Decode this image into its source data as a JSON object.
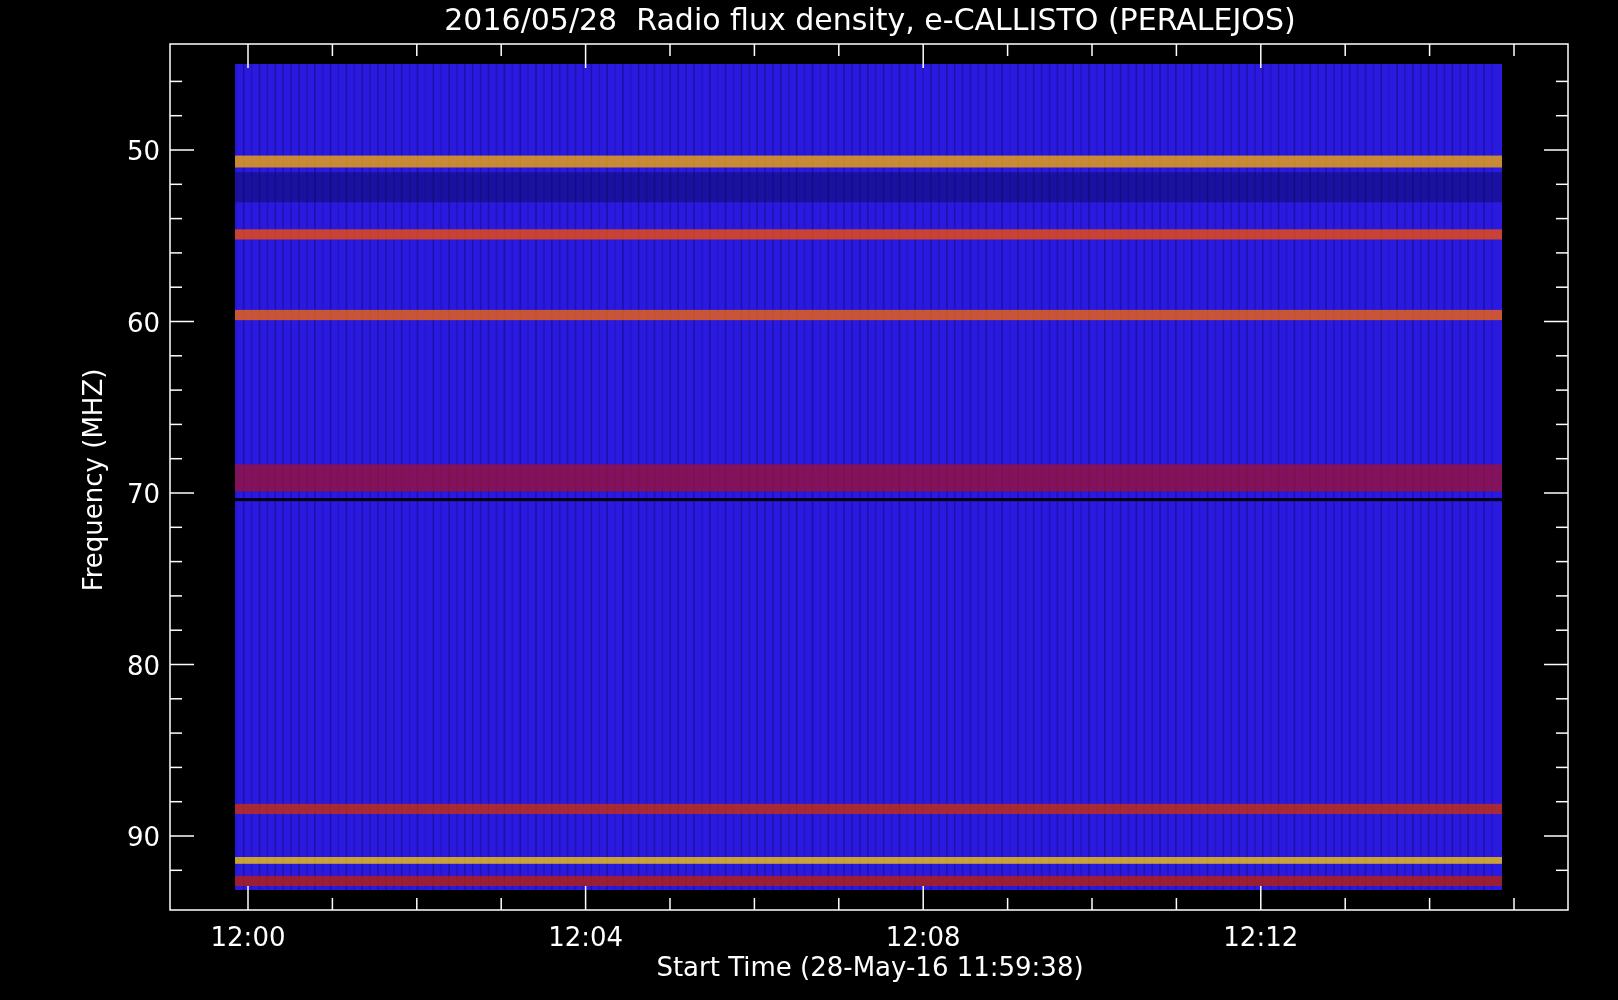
{
  "title": "2016/05/28  Radio flux density, e-CALLISTO (PERALEJOS)",
  "y_axis": {
    "label": "Frequency (MHZ)",
    "ticks": [
      "50",
      "60",
      "70",
      "80",
      "90"
    ]
  },
  "x_axis": {
    "label": "Start Time (28-May-16 11:59:38)",
    "ticks": [
      "12:00",
      "12:04",
      "12:08",
      "12:12"
    ]
  }
}
